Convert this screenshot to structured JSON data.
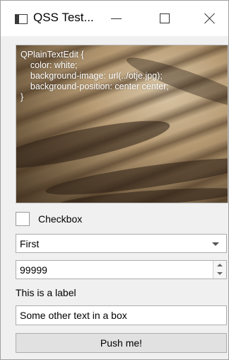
{
  "window": {
    "title": "QSS Test...",
    "icons": {
      "app": "window-app-icon",
      "minimize": "minimize-icon",
      "maximize": "maximize-icon",
      "close": "close-icon"
    }
  },
  "text_edit": {
    "content": "QPlainTextEdit {\n    color: white;\n    background-image: url(../otje.jpg);\n    background-position: center center;\n}"
  },
  "checkbox": {
    "label": "Checkbox",
    "checked": false
  },
  "combo": {
    "value": "First",
    "icon": "chevron-down-icon"
  },
  "spinbox": {
    "value": "99999",
    "icons": {
      "up": "arrow-up-icon",
      "down": "arrow-down-icon"
    }
  },
  "label": {
    "text": "This is a label"
  },
  "line_edit": {
    "value": "Some other text in a box"
  },
  "push_button": {
    "label": "Push me!"
  }
}
